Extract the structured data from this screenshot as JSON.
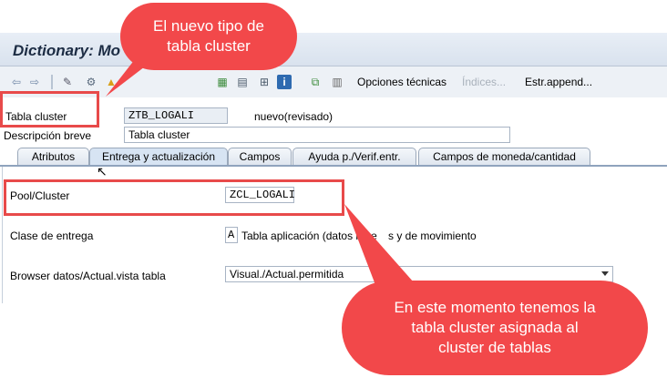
{
  "window": {
    "title": "Dictionary: Mo"
  },
  "toolbar": {
    "opciones": "Opciones técnicas",
    "indices": "Índices...",
    "estr_append": "Estr.append..."
  },
  "header": {
    "tabla_label": "Tabla cluster",
    "tabla_value": "ZTB_LOGALI",
    "tabla_status": "nuevo(revisado)",
    "desc_label": "Descripción breve",
    "desc_value": "Tabla cluster"
  },
  "tabs": [
    {
      "label": "Atributos"
    },
    {
      "label": "Entrega y actualización"
    },
    {
      "label": "Campos"
    },
    {
      "label": "Ayuda p./Verif.entr."
    },
    {
      "label": "Campos de moneda/cantidad"
    }
  ],
  "form": {
    "pool_label": "Pool/Cluster",
    "pool_value": "ZCL_LOGALI",
    "clase_label": "Clase de entrega",
    "clase_value": "A",
    "clase_desc": "Tabla aplicación (datos mae",
    "clase_desc_end": "s y de movimiento",
    "browser_label": "Browser datos/Actual.vista tabla",
    "browser_value": "Visual./Actual.permitida"
  },
  "callouts": {
    "top": "El nuevo tipo de tabla cluster",
    "bottom": "En este momento tenemos la tabla cluster asignada al cluster de tablas"
  },
  "colors": {
    "callout": "#f2484a",
    "highlight": "#e84a4a"
  }
}
